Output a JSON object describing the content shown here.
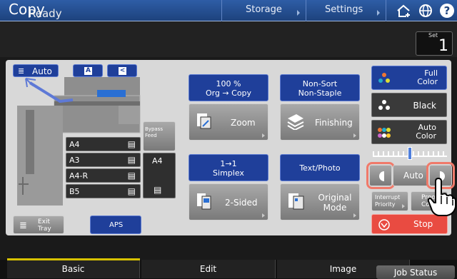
{
  "header": {
    "title": "Copy",
    "storage_label": "Storage",
    "settings_label": "Settings",
    "icons": [
      "home-add-icon",
      "globe-icon",
      "help-icon"
    ]
  },
  "status": {
    "text": "Ready",
    "set_label": "Set",
    "set_count": "1"
  },
  "machine": {
    "original_mode": "Auto",
    "paper_trays": [
      "A4",
      "A3",
      "A4-R",
      "B5"
    ],
    "bypass_label": "Bypass\nFeed",
    "bypass_size": "A4",
    "exit_tray_label": "Exit\nTray",
    "aps_label": "APS"
  },
  "functions": {
    "zoom": {
      "info_line1": "100 %",
      "info_line2": "Org → Copy",
      "label": "Zoom"
    },
    "finishing": {
      "info_line1": "Non-Sort",
      "info_line2": "Non-Staple",
      "label": "Finishing"
    },
    "duplex": {
      "info_line1": "1→1",
      "info_line2": "Simplex",
      "label": "2-Sided"
    },
    "original_mode": {
      "info": "Text/Photo",
      "label_line1": "Original",
      "label_line2": "Mode"
    }
  },
  "color_mode": {
    "full_color": "Full\nColor",
    "black": "Black",
    "auto_color": "Auto\nColor",
    "density_label": "Auto",
    "density_level": 0.5
  },
  "bottom_right": {
    "interrupt_label": "Interrupt\nPriority",
    "proof_label": "Proof\nCopy",
    "stop_label": "Stop"
  },
  "tabs": [
    "Basic",
    "Edit",
    "Image"
  ],
  "active_tab": "Basic",
  "job_status_label": "Job Status",
  "colors": {
    "title_bar": "#1d427d",
    "accent_blue": "#1f3f9a",
    "stop_red": "#e94b41",
    "tab_active": "#d7c200"
  }
}
